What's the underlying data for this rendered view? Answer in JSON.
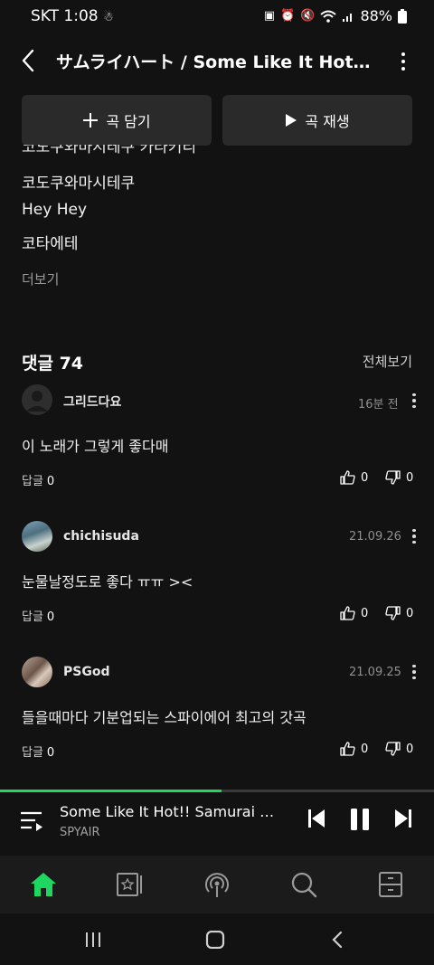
{
  "status_bar": {
    "carrier": "SKT",
    "time": "1:08",
    "battery": "88%"
  },
  "header": {
    "title": "サムライハート / Some Like It Hot!! Samurai Heart"
  },
  "actions": {
    "add_label": "곡 담기",
    "play_label": "곡 재생"
  },
  "lyrics": {
    "cut_line": "코도쿠와마시테쿠 카타키리",
    "lines": [
      "코도쿠와마시테쿠",
      "Hey Hey",
      "코타에테"
    ],
    "more_label": "더보기"
  },
  "comments": {
    "title": "댓글 74",
    "see_all": "전체보기",
    "items": [
      {
        "user": "그리드다요",
        "time": "16분 전",
        "text": "이 노래가 그렇게 좋다매",
        "reply_label": "답글",
        "reply_count": "0",
        "likes": "0",
        "dislikes": "0"
      },
      {
        "user": "chichisuda",
        "time": "21.09.26",
        "text": "눈물날정도로 좋다 ㅠㅠ ><",
        "reply_label": "답글",
        "reply_count": "0",
        "likes": "0",
        "dislikes": "0"
      },
      {
        "user": "PSGod",
        "time": "21.09.25",
        "text": "들을때마다 기분업되는 스파이에어 최고의 갓곡",
        "reply_label": "답글",
        "reply_count": "0",
        "likes": "0",
        "dislikes": "0"
      }
    ]
  },
  "player": {
    "title": "Some Like It Hot!! Samurai Heart",
    "artist": "SPYAIR",
    "progress": 0.51,
    "accent": "#1ed760"
  },
  "bottom_nav": {
    "items": [
      "home-icon",
      "library-icon",
      "podcast-icon",
      "search-icon",
      "storage-icon"
    ]
  }
}
